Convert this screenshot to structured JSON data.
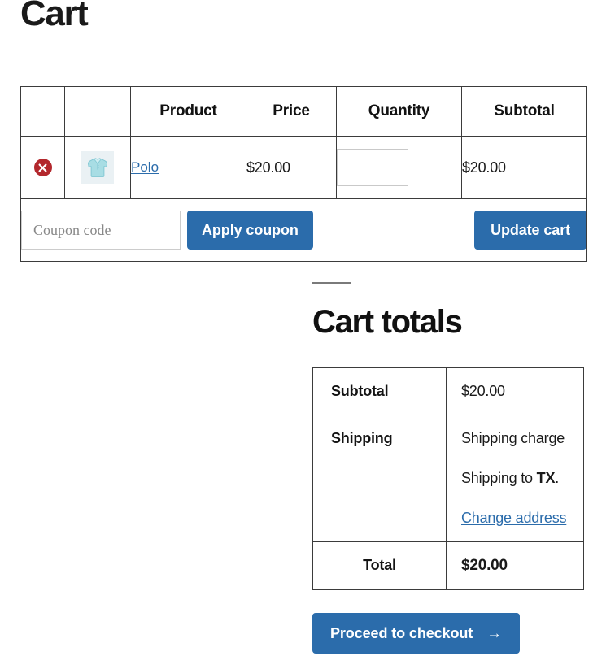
{
  "page": {
    "title": "Cart"
  },
  "cart_table": {
    "headers": {
      "remove": "",
      "thumbnail": "",
      "product": "Product",
      "price": "Price",
      "quantity": "Quantity",
      "subtotal": "Subtotal"
    },
    "rows": [
      {
        "remove_label": "×",
        "thumbnail_alt": "polo-shirt-thumbnail",
        "product_name": "Polo",
        "price": "$20.00",
        "quantity_value": "",
        "quantity_placeholder": "",
        "subtotal": "$20.00"
      }
    ],
    "actions": {
      "coupon_placeholder": "Coupon code",
      "coupon_value": "",
      "apply_coupon_label": "Apply coupon",
      "update_cart_label": "Update cart"
    }
  },
  "cart_totals": {
    "heading": "Cart totals",
    "rows": [
      {
        "label": "Subtotal",
        "value": "$20.00"
      },
      {
        "label": "Shipping",
        "value": "Shipping charge"
      },
      {
        "label": "Total",
        "value": "$20.00"
      }
    ],
    "shipping": {
      "method": "Shipping charge",
      "destination_prefix": "Shipping to ",
      "destination_state": "TX",
      "destination_suffix": ".",
      "change_address_label": "Change address"
    },
    "checkout_button_label": "Proceed to checkout",
    "checkout_arrow": "→"
  },
  "colors": {
    "accent_blue": "#2b6cab",
    "remove_red": "#b3282d",
    "border_gray": "#3b3b3b",
    "thumb_bg": "#eaf1f4"
  }
}
